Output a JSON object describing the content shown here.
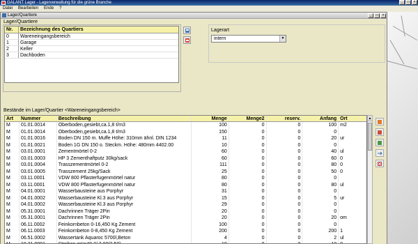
{
  "app": {
    "title": "GALANT Lager - Lagerverwaltung für die grüne Branche",
    "menu": [
      "Datei",
      "Bearbeiten",
      "Ende",
      "?"
    ]
  },
  "window": {
    "title": "Lager/Quartiere"
  },
  "quartiere": {
    "group_label": "Lager/Quartiere",
    "headers": {
      "nr": "Nr.",
      "bezeichnung": "Bezeichnung des Quartiers"
    },
    "rows": [
      {
        "nr": "0",
        "bezeichnung": "Wareneingangsbereich"
      },
      {
        "nr": "1",
        "bezeichnung": "Garage"
      },
      {
        "nr": "2",
        "bezeichnung": "Keller"
      },
      {
        "nr": "3",
        "bezeichnung": "Dachboden"
      }
    ]
  },
  "lagerart": {
    "label": "Lagerart",
    "value": "intern"
  },
  "bestaende": {
    "label": "Bestände im Lager/Quartier <Wareneingangsbereich>",
    "headers": {
      "art": "Art",
      "nummer": "Nummer",
      "beschreibung": "Beschreibung",
      "menge": "Menge",
      "menge2": "Menge2",
      "reserv": "reserv.",
      "anfang": "Anfang",
      "ort": "Ort"
    },
    "rows": [
      {
        "art": "M",
        "nummer": "01.01.0014",
        "beschreibung": "Oberboden,gesiebt,ca.1,8 t/m3",
        "menge": "100",
        "menge2": "0",
        "reserv": "0",
        "anfang": "100",
        "ort": "m2"
      },
      {
        "art": "M",
        "nummer": "01.01.0014",
        "beschreibung": "Oberboden,gesiebt,ca.1,8 t/m3",
        "menge": "150",
        "menge2": "0",
        "reserv": "0",
        "anfang": "0",
        "ort": ""
      },
      {
        "art": "M",
        "nummer": "01.01.0016",
        "beschreibung": "Boden DN 150 m. Muffe Höhe: 310mm ähnl. DIN 1234",
        "menge": "11",
        "menge2": "0",
        "reserv": "0",
        "anfang": "20",
        "ort": "ur"
      },
      {
        "art": "M",
        "nummer": "01.01.0021",
        "beschreibung": "Boden 1G DN 150 o. Steckm. Höhe: 480mm 4402.00",
        "menge": "10",
        "menge2": "0",
        "reserv": "0",
        "anfang": "0",
        "ort": ""
      },
      {
        "art": "M",
        "nummer": "03.01.0001",
        "beschreibung": "Zementmörtel 0-2",
        "menge": "60",
        "menge2": "0",
        "reserv": "0",
        "anfang": "40",
        "ort": "ul"
      },
      {
        "art": "M",
        "nummer": "03.01.0003",
        "beschreibung": "HP 3 Zementhaftputz 30kg/sack",
        "menge": "60",
        "menge2": "0",
        "reserv": "0",
        "anfang": "60",
        "ort": "0"
      },
      {
        "art": "M",
        "nummer": "03.01.0004",
        "beschreibung": "Trasszementmörtel 0-2",
        "menge": "111",
        "menge2": "0",
        "reserv": "0",
        "anfang": "80",
        "ort": "0"
      },
      {
        "art": "M",
        "nummer": "03.01.0005",
        "beschreibung": "Trasszement  25kg/Sack",
        "menge": "25",
        "menge2": "0",
        "reserv": "0",
        "anfang": "50",
        "ort": "0"
      },
      {
        "art": "M",
        "nummer": "03.11.0001",
        "beschreibung": "VDW 800 Pflasterfugenmörtel natur",
        "menge": "80",
        "menge2": "0",
        "reserv": "0",
        "anfang": "0",
        "ort": ""
      },
      {
        "art": "M",
        "nummer": "03.11.0001",
        "beschreibung": "VDW 800 Pflasterfugenmörtel natur",
        "menge": "80",
        "menge2": "0",
        "reserv": "0",
        "anfang": "80",
        "ort": "ul"
      },
      {
        "art": "M",
        "nummer": "04.01.0001",
        "beschreibung": "Wasserbausteine aus Porphyr",
        "menge": "31",
        "menge2": "0",
        "reserv": "0",
        "anfang": "0",
        "ort": ""
      },
      {
        "art": "M",
        "nummer": "04.01.0002",
        "beschreibung": "Wasserbausteine Kl.3 aus Porphyr",
        "menge": "15",
        "menge2": "0",
        "reserv": "0",
        "anfang": "5",
        "ort": "ur"
      },
      {
        "art": "M",
        "nummer": "04.01.0002",
        "beschreibung": "Wasserbausteine Kl.3 aus Porphyr",
        "menge": "29",
        "menge2": "0",
        "reserv": "0",
        "anfang": "0",
        "ort": ""
      },
      {
        "art": "M",
        "nummer": "05.31.0001",
        "beschreibung": "Dachrinnen Träger 2Pin",
        "menge": "20",
        "menge2": "0",
        "reserv": "0",
        "anfang": "0",
        "ort": ""
      },
      {
        "art": "M",
        "nummer": "05.31.0001",
        "beschreibung": "Dachrinnen Träger 2Pin",
        "menge": "20",
        "menge2": "0",
        "reserv": "0",
        "anfang": "20",
        "ort": "om"
      },
      {
        "art": "M",
        "nummer": "06.11.0002",
        "beschreibung": "Feinkornbeton 0-16,450 Kg Zement",
        "menge": "100",
        "menge2": "0",
        "reserv": "0",
        "anfang": "0",
        "ort": ""
      },
      {
        "art": "M",
        "nummer": "06.11.0003",
        "beschreibung": "Feinkornbeton 0-8,450 Kg Zement",
        "menge": "200",
        "menge2": "0",
        "reserv": "0",
        "anfang": "200",
        "ort": "1"
      },
      {
        "art": "M",
        "nummer": "06.51.0002",
        "beschreibung": "Wassertank Aquaroc 5700l,Beton",
        "menge": "4",
        "menge2": "0",
        "reserv": "0",
        "anfang": "2",
        "ort": "ul"
      },
      {
        "art": "M",
        "nummer": "10.31.0001",
        "beschreibung": "Streben,grün48,3/ 2,00(2,50)",
        "menge": "10",
        "menge2": "0",
        "reserv": "0",
        "anfang": "10",
        "ort": "0"
      }
    ]
  }
}
